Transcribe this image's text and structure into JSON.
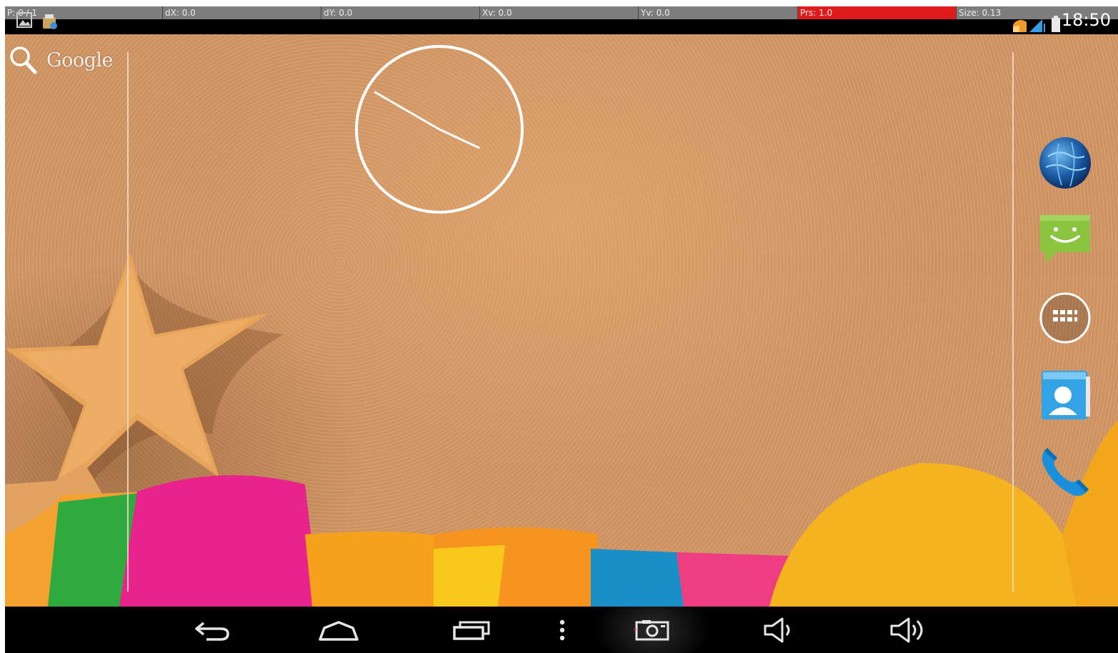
{
  "pointer_location": {
    "p": "P: 0 / 1",
    "dx": "dX: 0.0",
    "dy": "dY: 0.0",
    "xv": "Xv: 0.0",
    "yv": "Yv: 0.0",
    "prs": "Prs: 1.0",
    "size": "Size: 0.13",
    "prs_highlight_color": "#e01b1b"
  },
  "status_bar": {
    "time": "18:50",
    "left_icons": [
      "gallery-notification-icon",
      "storage-notification-icon"
    ],
    "right_icons": [
      "wifi-icon",
      "signal-icon",
      "battery-icon"
    ]
  },
  "home_screen": {
    "search_widget_label": "Google",
    "clock_widget": {
      "hour": 9,
      "minute": 50
    },
    "dock": [
      "browser-icon",
      "messaging-icon",
      "app-drawer-icon",
      "contacts-icon",
      "phone-icon"
    ]
  },
  "navigation_bar": {
    "buttons": [
      "back-button",
      "home-button",
      "recent-apps-button",
      "menu-button",
      "screenshot-button",
      "volume-down-button",
      "volume-up-button"
    ]
  },
  "colors": {
    "sand": "#cf9564",
    "status_bar": "#000000",
    "pointer_bar": "#7d7d7d",
    "message_green": "#8bc53f",
    "phone_blue": "#1c8fdc"
  }
}
